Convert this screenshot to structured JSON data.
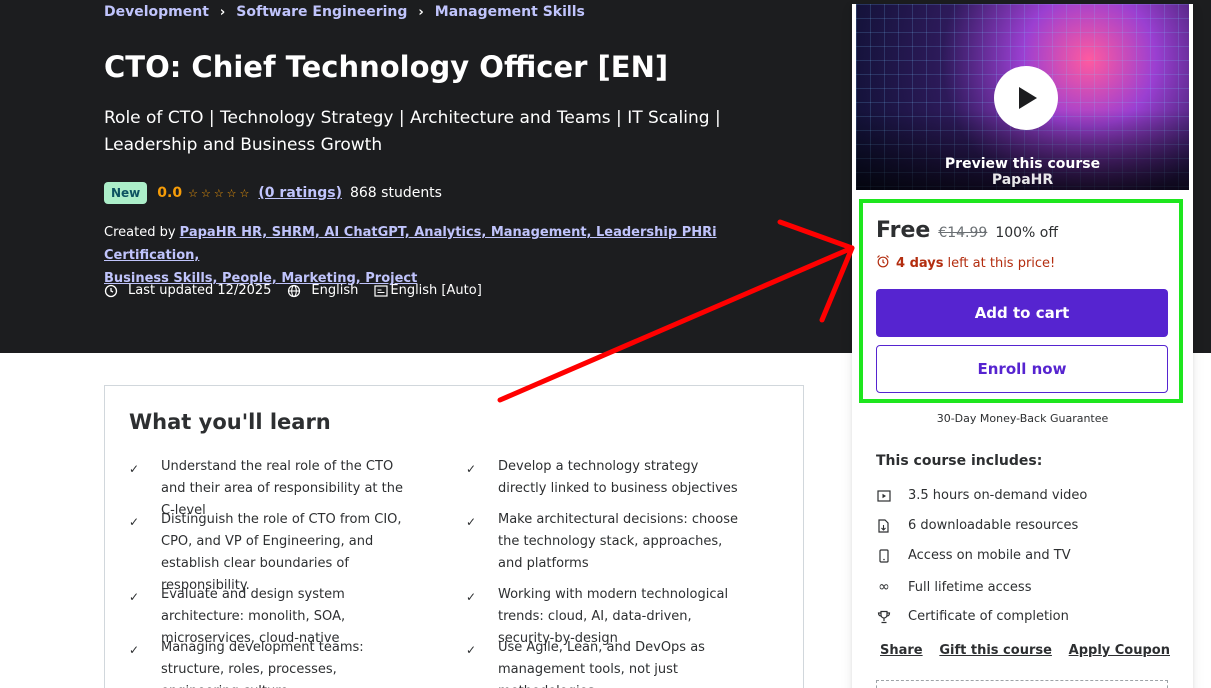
{
  "breadcrumb": [
    "Development",
    "Software Engineering",
    "Management Skills"
  ],
  "course": {
    "title": "CTO: Chief Technology Officer [EN]",
    "subtitle": "Role of CTO | Technology Strategy | Architecture and Teams | IT Scaling | Leadership and Business Growth",
    "badge": "New",
    "rating": "0.0",
    "ratings_link": "(0 ratings)",
    "students": "868 students",
    "created_by_label": "Created by",
    "created_by_line1": "PapaHR  HR, SHRM, AI ChatGPT, Analytics, Management, Leadership PHRi Certification,",
    "created_by_line2": "Business Skills, People, Marketing, Project",
    "last_updated": "Last updated 12/2025",
    "language": "English",
    "captions": "English [Auto]"
  },
  "learn": {
    "heading": "What you'll learn",
    "items": [
      "Understand the real role of the CTO and their area of responsibility at the C-level",
      "Develop a technology strategy directly linked to business objectives",
      "Distinguish the role of CTO from CIO, CPO, and VP of Engineering, and establish clear boundaries of responsibility.",
      "Make architectural decisions: choose the technology stack, approaches, and platforms",
      "Evaluate and design system architecture: monolith, SOA, microservices, cloud-native",
      "Working with modern technological trends: cloud, AI, data-driven, security-by-design",
      "Managing development teams: structure, roles, processes, engineering culture",
      "Use Agile, Lean, and DevOps as management tools, not just methodologies."
    ]
  },
  "sidebar": {
    "preview_label": "Preview this course",
    "brand_text": "PapaHR",
    "price": "Free",
    "old_price": "€14.99",
    "discount": "100% off",
    "timer_bold": "4 days",
    "timer_rest": "left at this price!",
    "add_to_cart": "Add to cart",
    "enroll_now": "Enroll now",
    "guarantee": "30-Day Money-Back Guarantee",
    "includes_title": "This course includes:",
    "includes": [
      {
        "icon": "video-icon",
        "text": "3.5 hours on-demand video"
      },
      {
        "icon": "file-download-icon",
        "text": "6 downloadable resources"
      },
      {
        "icon": "mobile-icon",
        "text": "Access on mobile and TV"
      },
      {
        "icon": "infinity-icon",
        "text": "Full lifetime access"
      },
      {
        "icon": "trophy-icon",
        "text": "Certificate of completion"
      }
    ],
    "share": "Share",
    "gift": "Gift this course",
    "coupon": "Apply Coupon"
  },
  "colors": {
    "hero_bg": "#1c1d1f",
    "link": "#c0c4fc",
    "star": "#f69c08",
    "brand_purple": "#5624d0",
    "timer_red": "#b32d0f",
    "highlight_green": "#1ee61e",
    "arrow_red": "#ff0000"
  }
}
